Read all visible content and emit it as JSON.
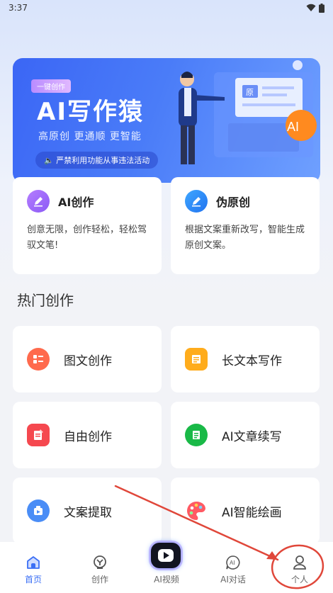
{
  "status_bar": {
    "time": "3:37"
  },
  "banner": {
    "tag": "一键创作",
    "title": "AI写作猿",
    "subtitle": "高原创 更通顺 更智能",
    "notice": "严禁利用功能从事违法活动",
    "art_badge_text": "原",
    "art_ai_text": "AI"
  },
  "top_cards": [
    {
      "title": "AI创作",
      "desc": "创意无限，创作轻松，轻松驾驭文笔!"
    },
    {
      "title": "伪原创",
      "desc": "根据文案重新改写，智能生成原创文案。"
    }
  ],
  "section_title": "热门创作",
  "grid": [
    {
      "label": "图文创作",
      "icon": "image-text-icon",
      "color": "#ff6a4d"
    },
    {
      "label": "长文本写作",
      "icon": "document-icon",
      "color": "#ffac1c"
    },
    {
      "label": "自由创作",
      "icon": "edit-doc-icon",
      "color": "#f5484f"
    },
    {
      "label": "AI文章续写",
      "icon": "article-icon",
      "color": "#19b947"
    },
    {
      "label": "文案提取",
      "icon": "extract-icon",
      "color": "#4a8df6"
    },
    {
      "label": "AI智能绘画",
      "icon": "palette-icon",
      "color": "#ff5a63"
    }
  ],
  "nav": {
    "home": "首页",
    "create": "创作",
    "video": "AI视频",
    "chat": "AI对话",
    "profile": "个人"
  },
  "colors": {
    "accent": "#3b6ff5",
    "annotation": "#e0473a"
  }
}
